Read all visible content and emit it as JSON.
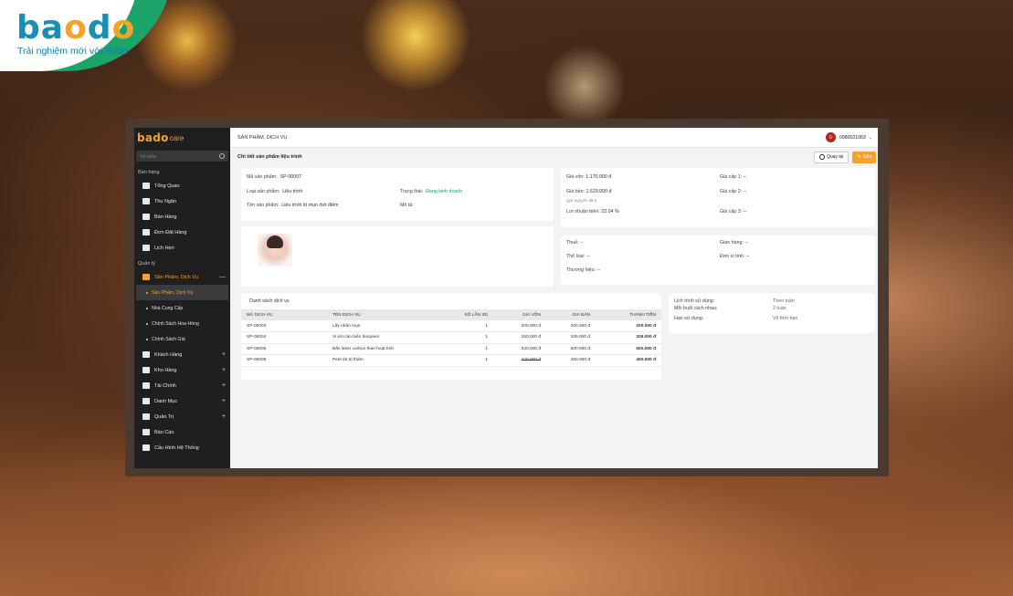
{
  "brand": {
    "logo_b": "ba",
    "logo_d": "d",
    "logo_o": "o",
    "tagline": "Trải nghiệm mới với Bado"
  },
  "app": {
    "logo_main": "bado",
    "logo_sub": "care",
    "search_placeholder": "Tìm kiếm",
    "sections": {
      "sales": "Bán hàng",
      "manage": "Quản lý"
    },
    "sales_items": [
      "Tổng Quan",
      "Thu Ngân",
      "Bán Hàng",
      "Đơn Đặt Hàng",
      "Lịch Hẹn"
    ],
    "manage_active": "Sản Phẩm, Dịch Vụ",
    "sub_items": [
      "Sản Phẩm, Dịch Vụ",
      "Nhà Cung Cấp",
      "Chính Sách Hoa Hồng",
      "Chính Sách Giá"
    ],
    "manage_items": [
      "Khách Hàng",
      "Kho Hàng",
      "Tài Chính",
      "Danh Mục",
      "Quản Trị",
      "Báo Cáo",
      "Cấu Hình Hệ Thống"
    ],
    "collapse_mark": "—",
    "plus": "+"
  },
  "topbar": {
    "title": "SẢN PHẨM, DỊCH VỤ",
    "user_avatar": "0",
    "user_phone": "0980021063",
    "chevron": "⌄"
  },
  "subbar": {
    "heading": "Chi tiết sản phẩm liệu trình",
    "back_label": "Quay lại",
    "edit_label": "Sửa"
  },
  "info": {
    "code_label": "Mã sản phẩm:",
    "code_value": "SP-00007",
    "type_label": "Loại sản phẩm:",
    "type_value": "Liệu trình",
    "status_label": "Trạng thái:",
    "status_value": "Đang kinh doanh",
    "name_label": "Tên sản phẩm:",
    "name_value": "Liệu trình trị mụn dứt điểm",
    "desc_label": "Mô tả:"
  },
  "pricing": {
    "cost_label": "Giá vốn:",
    "cost_value": "1.170.000 đ",
    "sell_label": "Giá bán:",
    "sell_value": "1.629.000 đ",
    "sell_note": "(giá nguyên liệu)",
    "margin_label": "Lợi nhuận biên:",
    "margin_value": "22.04 %",
    "level1_label": "Giá cấp 1:",
    "level1_value": "--",
    "level2_label": "Giá cấp 2:",
    "level2_value": "--",
    "level3_label": "Giá cấp 3:",
    "level3_value": "--"
  },
  "attributes": {
    "tax_label": "Thuế:",
    "tax_value": "--",
    "kiosk_label": "Gian hàng:",
    "kiosk_value": "--",
    "category_label": "Thể loại:",
    "category_value": "--",
    "unit_label": "Đơn vị tính:",
    "unit_value": "--",
    "brand_label": "Thương hiệu:",
    "brand_value": "--"
  },
  "services": {
    "title": "Danh sách dịch vụ",
    "headers": [
      "MÃ DỊCH VỤ",
      "TÊN DỊCH VỤ",
      "SỐ LẦN SD",
      "GIÁ VỐN",
      "GIÁ BÁN",
      "THÀNH TIỀN"
    ],
    "rows": [
      [
        "SP-00003",
        "Lấy nhân mụn",
        "1",
        "200.000 đ",
        "200.000 đ",
        "200.000 đ"
      ],
      [
        "SP-00004",
        "Vi kim tảo biển bioqreen",
        "1",
        "250.000 đ",
        "209.000 đ",
        "209.000 đ"
      ],
      [
        "SP-00005",
        "Bắn laser carbon than hoạt tính",
        "1",
        "520.000 đ",
        "500.000 đ",
        "500.000 đ"
      ],
      [
        "SP-00006",
        "Peel da trị thâm",
        "1",
        "320.000 đ",
        "450.000 đ",
        "450.000 đ"
      ]
    ]
  },
  "schedule": {
    "use_label": "Lịch trình sử dụng:",
    "use_value": "Theo tuần",
    "interval_label": "Mỗi buổi cách nhau:",
    "interval_value": "2 tuần",
    "expiry_label": "Hạn sử dụng:",
    "expiry_value": "Vô thời hạn"
  }
}
